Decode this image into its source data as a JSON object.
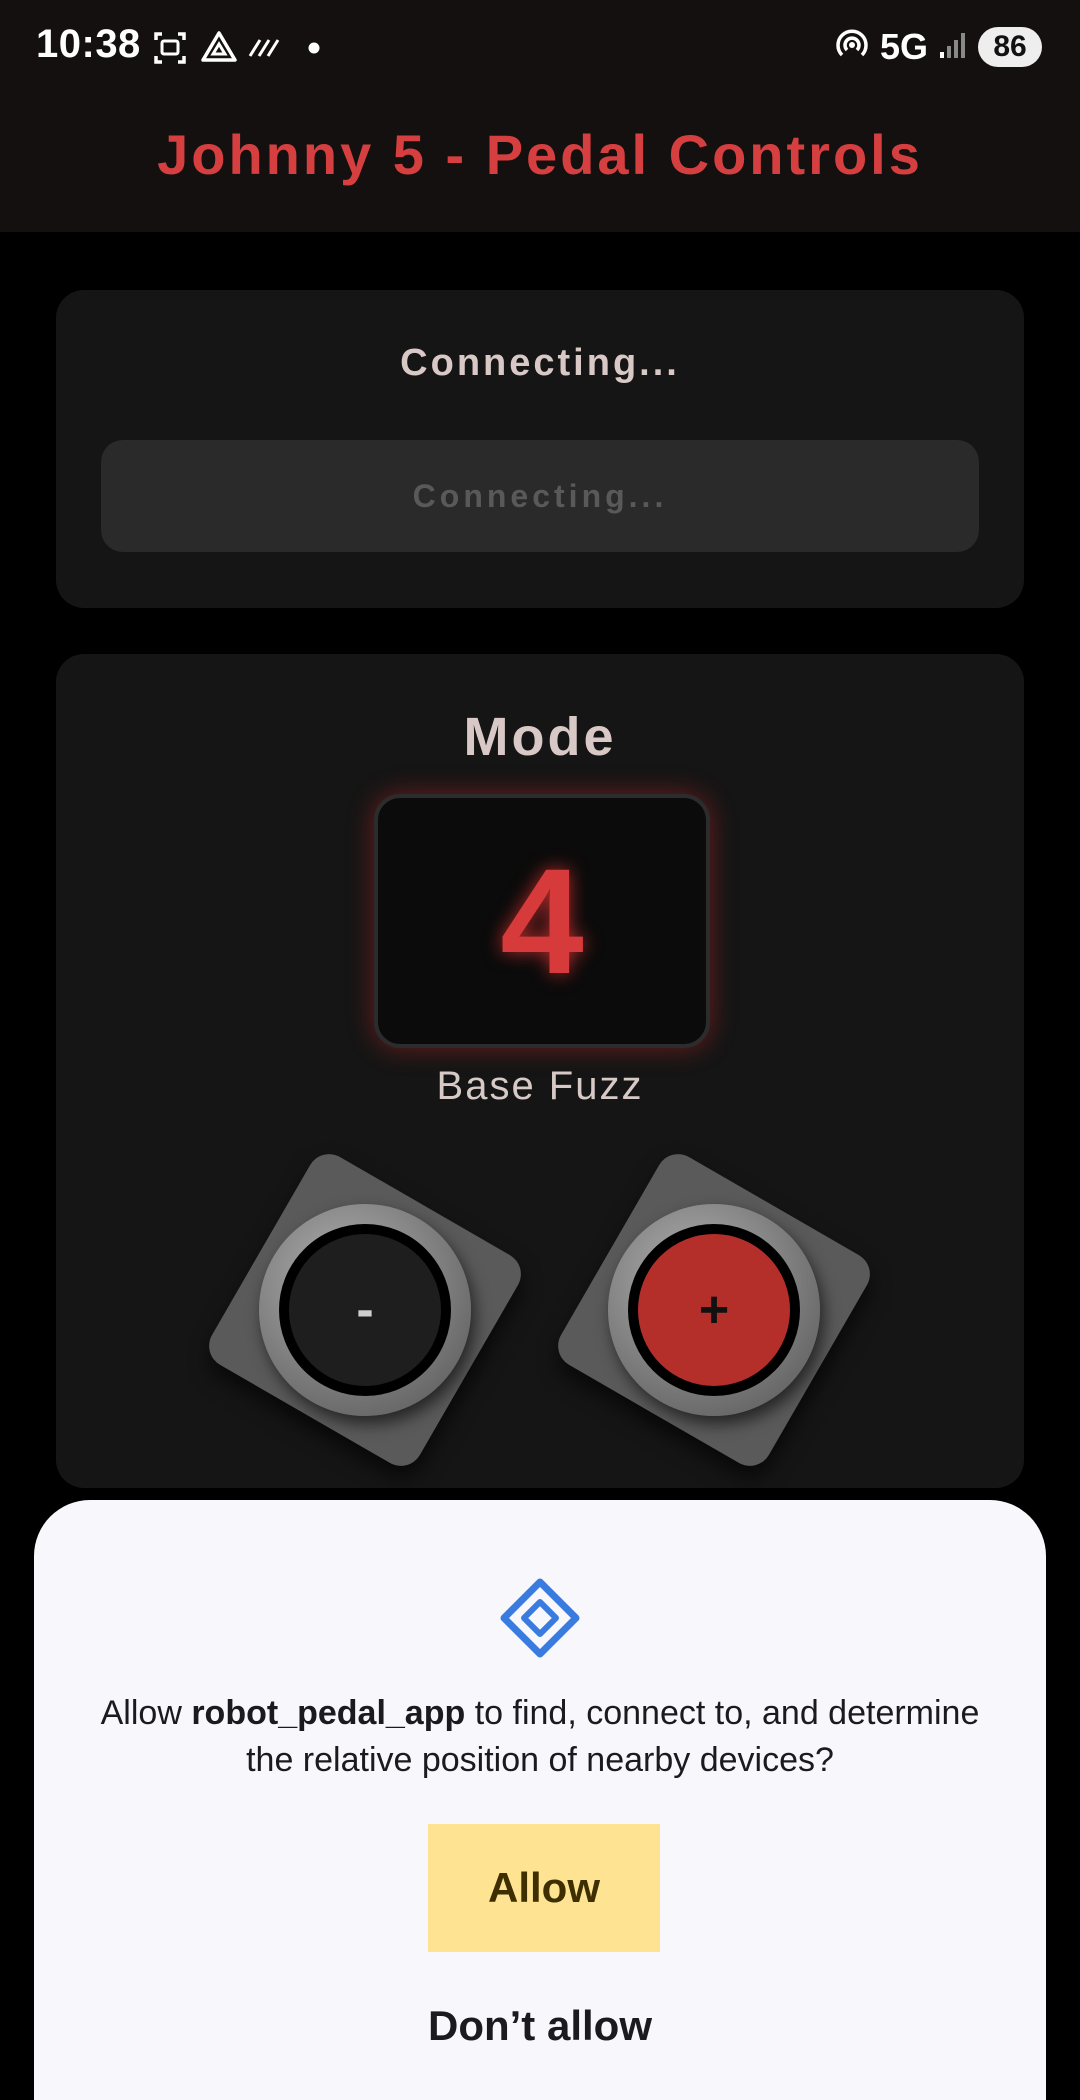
{
  "status_bar": {
    "time": "10:38",
    "network": "5G",
    "battery": "86",
    "icons": [
      "screen-record-icon",
      "drive-icon",
      "stripes-icon",
      "dot-icon",
      "hotspot-icon",
      "signal-icon"
    ]
  },
  "app_bar": {
    "title": "Johnny 5 - Pedal Controls"
  },
  "connection": {
    "status": "Connecting...",
    "button_label": "Connecting..."
  },
  "mode": {
    "label": "Mode",
    "value": "4",
    "name": "Base Fuzz",
    "minus_label": "-",
    "plus_label": "+"
  },
  "permission_dialog": {
    "text_prefix": "Allow ",
    "app_name": "robot_pedal_app",
    "text_suffix": " to find, connect to, and determine the relative position of nearby devices?",
    "allow_label": "Allow",
    "deny_label": "Don’t allow",
    "icon": "nearby-devices-icon"
  },
  "colors": {
    "accent_red": "#d63f3f",
    "allow_yellow": "#fde392",
    "icon_blue": "#3a7be0"
  }
}
